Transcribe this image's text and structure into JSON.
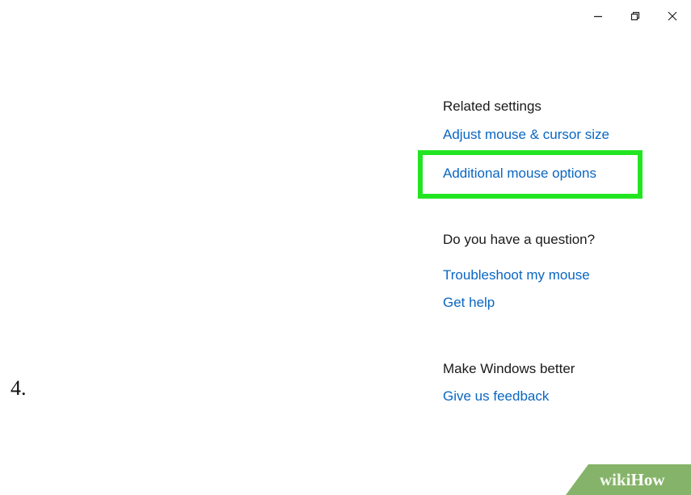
{
  "window_controls": {
    "minimize_icon": "minimize-icon",
    "restore_icon": "restore-icon",
    "close_icon": "close-icon"
  },
  "related_settings": {
    "heading": "Related settings",
    "links": [
      "Adjust mouse & cursor size",
      "Additional mouse options"
    ]
  },
  "question": {
    "heading": "Do you have a question?",
    "links": [
      "Troubleshoot my mouse",
      "Get help"
    ]
  },
  "feedback": {
    "heading": "Make Windows better",
    "link": "Give us feedback"
  },
  "annotation": {
    "step_number": "4.",
    "highlight_color": "#22e522"
  },
  "watermark": {
    "wiki": "wiki",
    "how": "How"
  },
  "colors": {
    "link": "#0a66c2",
    "text": "#1a1a1a",
    "watermark_bg": "#86b36a"
  }
}
